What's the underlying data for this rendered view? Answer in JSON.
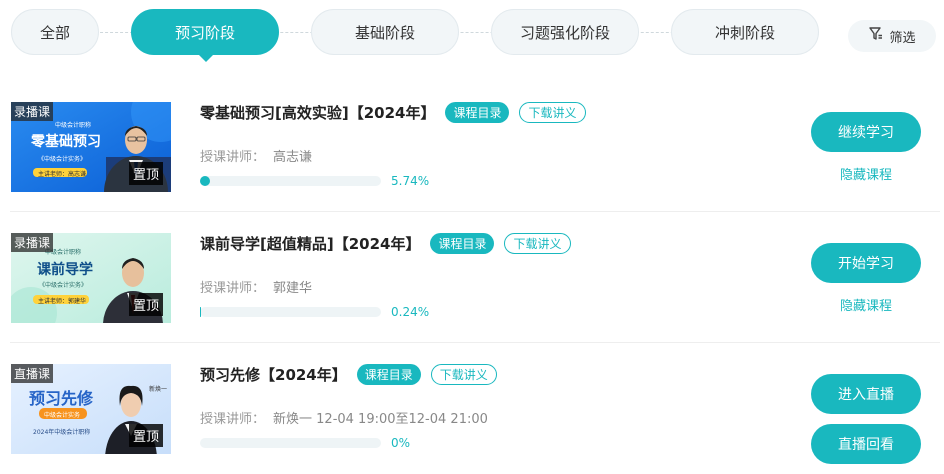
{
  "tabs": [
    {
      "label": "全部",
      "active": false
    },
    {
      "label": "预习阶段",
      "active": true
    },
    {
      "label": "基础阶段",
      "active": false
    },
    {
      "label": "习题强化阶段",
      "active": false
    },
    {
      "label": "冲刺阶段",
      "active": false
    }
  ],
  "filter": {
    "label": "筛选",
    "icon": "filter-icon"
  },
  "colors": {
    "accent": "#19b8bf",
    "tab_bg": "#f2f6f8",
    "progress_track": "#eef4f6"
  },
  "courses": [
    {
      "thumb": {
        "tag": "录播课",
        "pin": "置顶",
        "exam": "中级会计职称",
        "big": "零基础预习",
        "subject": "《中级会计实务》",
        "chip": "主讲老师：高志谦"
      },
      "title": "零基础预习[高效实验]【2024年】",
      "catalog": "课程目录",
      "download": "下载讲义",
      "teacher_label": "授课讲师：",
      "teacher": "高志谦",
      "progress_text": "5.74%",
      "progress": 0.0574,
      "primary_button": "继续学习",
      "secondary_link": "隐藏课程"
    },
    {
      "thumb": {
        "tag": "录播课",
        "pin": "置顶",
        "exam": "中级会计职称",
        "big": "课前导学",
        "subject": "《中级会计实务》",
        "chip": "主讲老师：郭建华"
      },
      "title": "课前导学[超值精品]【2024年】",
      "catalog": "课程目录",
      "download": "下载讲义",
      "teacher_label": "授课讲师：",
      "teacher": "郭建华",
      "progress_text": "0.24%",
      "progress": 0.0024,
      "primary_button": "开始学习",
      "secondary_link": "隐藏课程"
    },
    {
      "thumb": {
        "tag": "直播课",
        "pin": "置顶",
        "big": "预习先修",
        "chip": "中级会计实务",
        "year": "2024年中级会计职称",
        "side": "新焕一"
      },
      "title": "预习先修【2024年】",
      "catalog": "课程目录",
      "download": "下载讲义",
      "teacher_label": "授课讲师：",
      "teacher": "新焕一 12-04 19:00至12-04 21:00",
      "progress_text": "0%",
      "progress": 0,
      "primary_button": "进入直播",
      "secondary_button": "直播回看"
    }
  ]
}
